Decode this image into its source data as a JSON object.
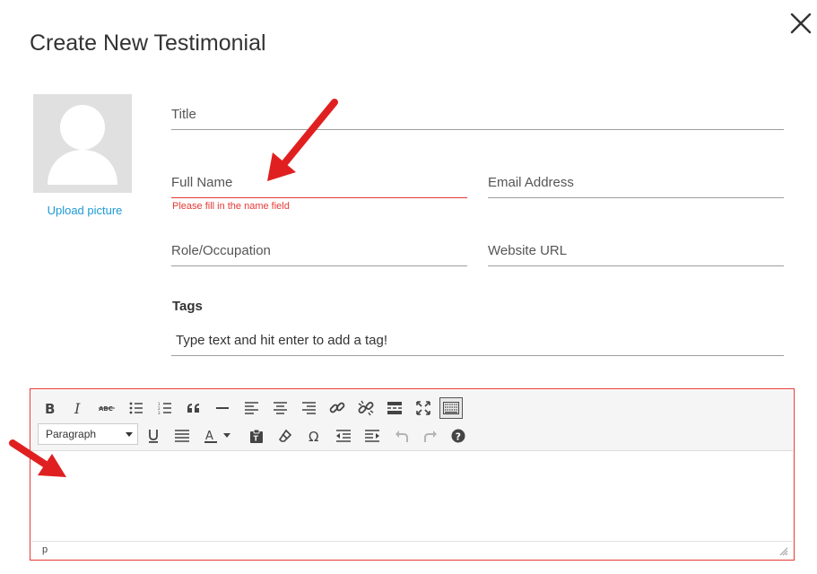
{
  "modal": {
    "title": "Create New Testimonial",
    "close_icon": "close-icon"
  },
  "avatar": {
    "upload_label": "Upload picture",
    "icon": "user-silhouette-icon"
  },
  "form": {
    "title_label": "Title",
    "full_name_label": "Full Name",
    "full_name_error": "Please fill in the name field",
    "email_label": "Email Address",
    "role_label": "Role/Occupation",
    "website_label": "Website URL",
    "tags_heading": "Tags",
    "tags_placeholder": "Type text and hit enter to add a tag!"
  },
  "editor": {
    "format_select": "Paragraph",
    "status_path": "p",
    "toolbar_row1": [
      "bold-icon",
      "italic-icon",
      "strikethrough-icon",
      "bullet-list-icon",
      "numbered-list-icon",
      "blockquote-icon",
      "horizontal-line-icon",
      "align-left-icon",
      "align-center-icon",
      "align-right-icon",
      "link-icon",
      "unlink-icon",
      "read-more-icon",
      "fullscreen-icon",
      "toolbar-toggle-icon"
    ],
    "toolbar_row2": [
      "underline-icon",
      "justify-icon",
      "text-color-icon",
      "paste-text-icon",
      "clear-formatting-icon",
      "special-character-icon",
      "outdent-icon",
      "indent-icon",
      "undo-icon",
      "redo-icon",
      "help-icon"
    ]
  },
  "colors": {
    "accent_link": "#1e9ad6",
    "error": "#e53935",
    "annotation_arrow": "#e02020"
  }
}
